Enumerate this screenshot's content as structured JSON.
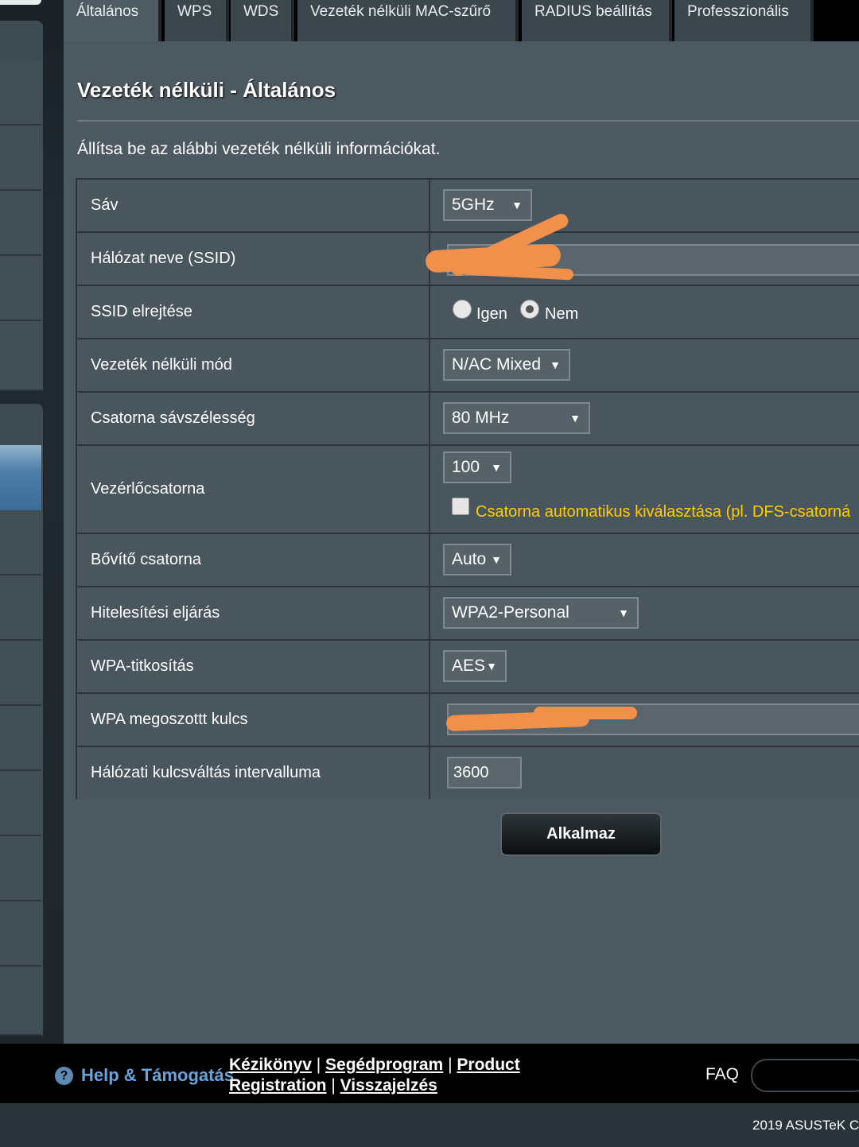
{
  "tabs": [
    "Általános",
    "WPS",
    "WDS",
    "Vezeték nélküli MAC-szűrő",
    "RADIUS beállítás",
    "Professzionális"
  ],
  "title": "Vezeték nélküli - Általános",
  "intro": "Állítsa be az alábbi vezeték nélküli információkat.",
  "rows": {
    "band": {
      "label": "Sáv",
      "value": "5GHz"
    },
    "ssid": {
      "label": "Hálózat neve (SSID)",
      "value": ""
    },
    "hide_ssid": {
      "label": "SSID elrejtése",
      "opt_yes": "Igen",
      "opt_no": "Nem",
      "selected": "Nem"
    },
    "mode": {
      "label": "Vezeték nélküli mód",
      "value": "N/AC Mixed"
    },
    "bandwidth": {
      "label": "Csatorna sávszélesség",
      "value": "80 MHz"
    },
    "control_channel": {
      "label": "Vezérlőcsatorna",
      "value": "100",
      "auto_hint": "Csatorna automatikus kiválasztása (pl. DFS-csatorná",
      "auto_checked": false
    },
    "ext_channel": {
      "label": "Bővítő csatorna",
      "value": "Auto"
    },
    "auth": {
      "label": "Hitelesítési eljárás",
      "value": "WPA2-Personal"
    },
    "encryption": {
      "label": "WPA-titkosítás",
      "value": "AES"
    },
    "psk": {
      "label": "WPA megoszottt kulcs",
      "value": ""
    },
    "rekey": {
      "label": "Hálózati kulcsváltás intervalluma",
      "value": "3600"
    }
  },
  "apply_label": "Alkalmaz",
  "arrow": "▼",
  "help_icon": "?",
  "footer": {
    "help": "Help & Támogatás",
    "links": [
      "Kézikönyv",
      "Segédprogram",
      "Product Registration",
      "Visszajelzés"
    ],
    "sep": "|",
    "faq": "FAQ",
    "copyright": "2019 ASUSTeK C"
  }
}
